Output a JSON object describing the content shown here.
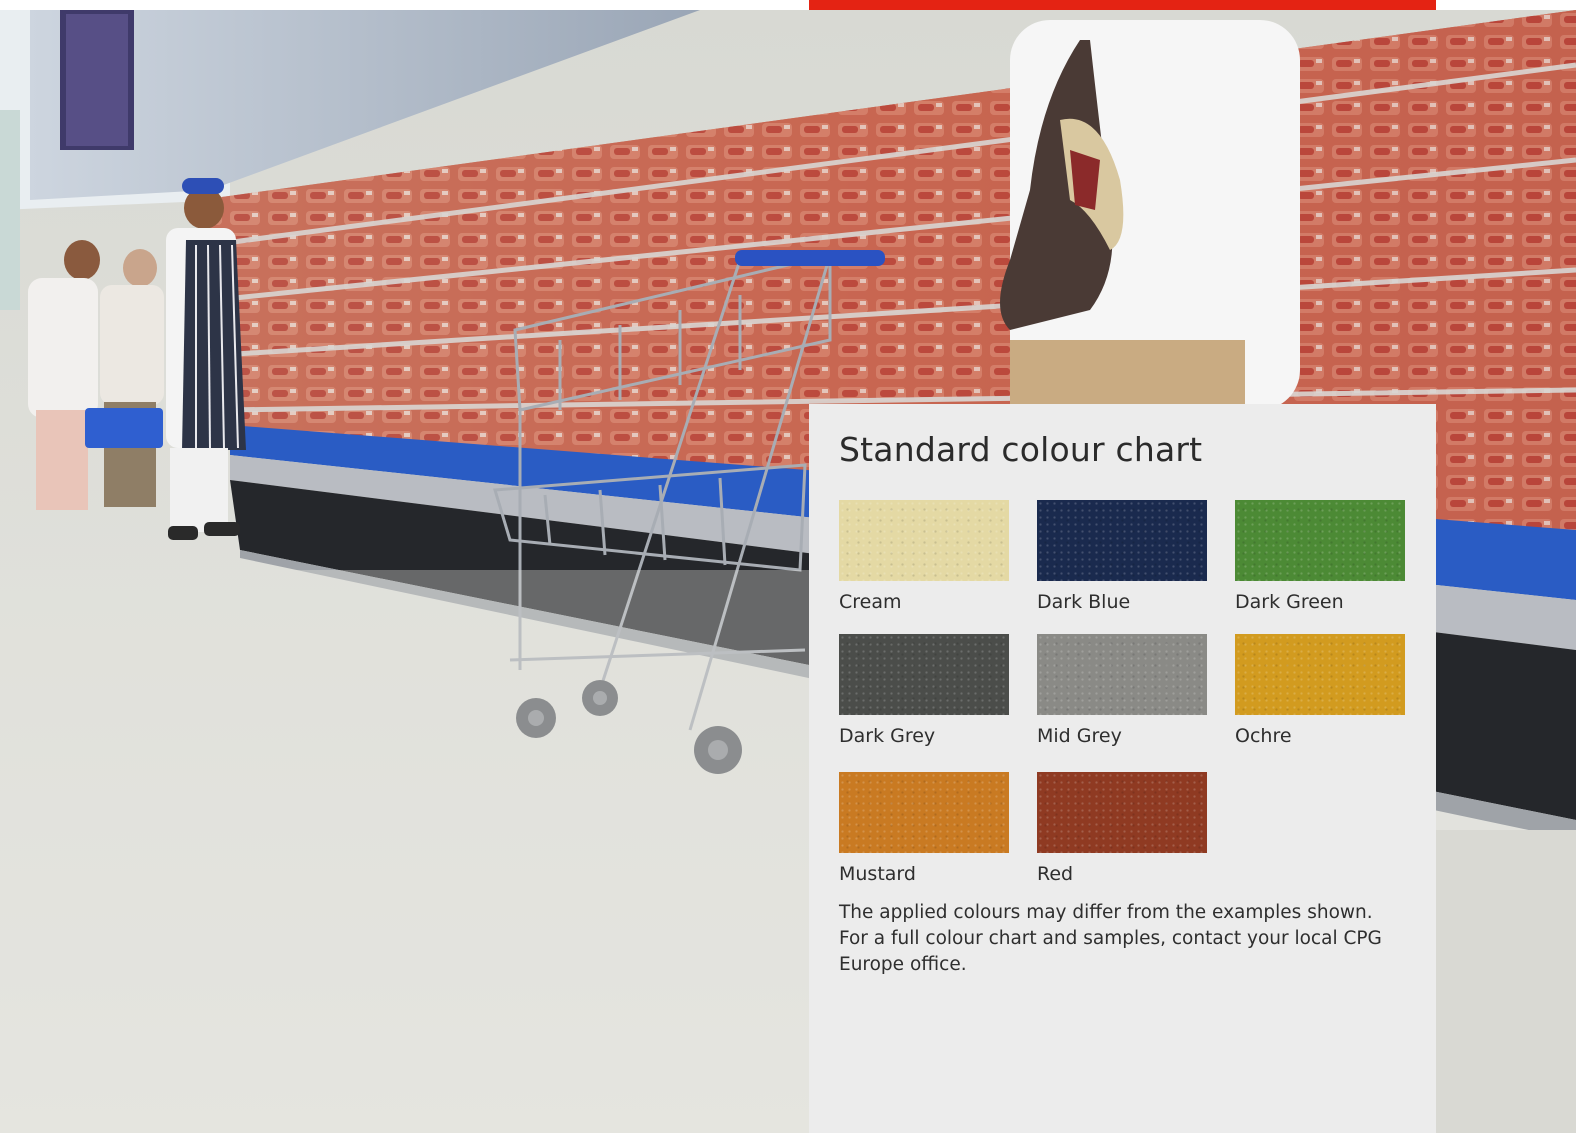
{
  "colour_chart": {
    "title": "Standard colour chart",
    "swatches": [
      {
        "name": "Cream",
        "color": "#e4d9a4"
      },
      {
        "name": "Dark Blue",
        "color": "#1a2a4e"
      },
      {
        "name": "Dark Green",
        "color": "#4c8a35"
      },
      {
        "name": "Dark Grey",
        "color": "#4b4d4a"
      },
      {
        "name": "Mid Grey",
        "color": "#8a8a86"
      },
      {
        "name": "Ochre",
        "color": "#d29b1f"
      },
      {
        "name": "Mustard",
        "color": "#c97a22"
      },
      {
        "name": "Red",
        "color": "#8f3a22"
      }
    ],
    "note": "The applied colours may differ from the examples shown. For a full colour chart and samples, contact your local CPG Europe office."
  },
  "accent_color": "#e42313"
}
